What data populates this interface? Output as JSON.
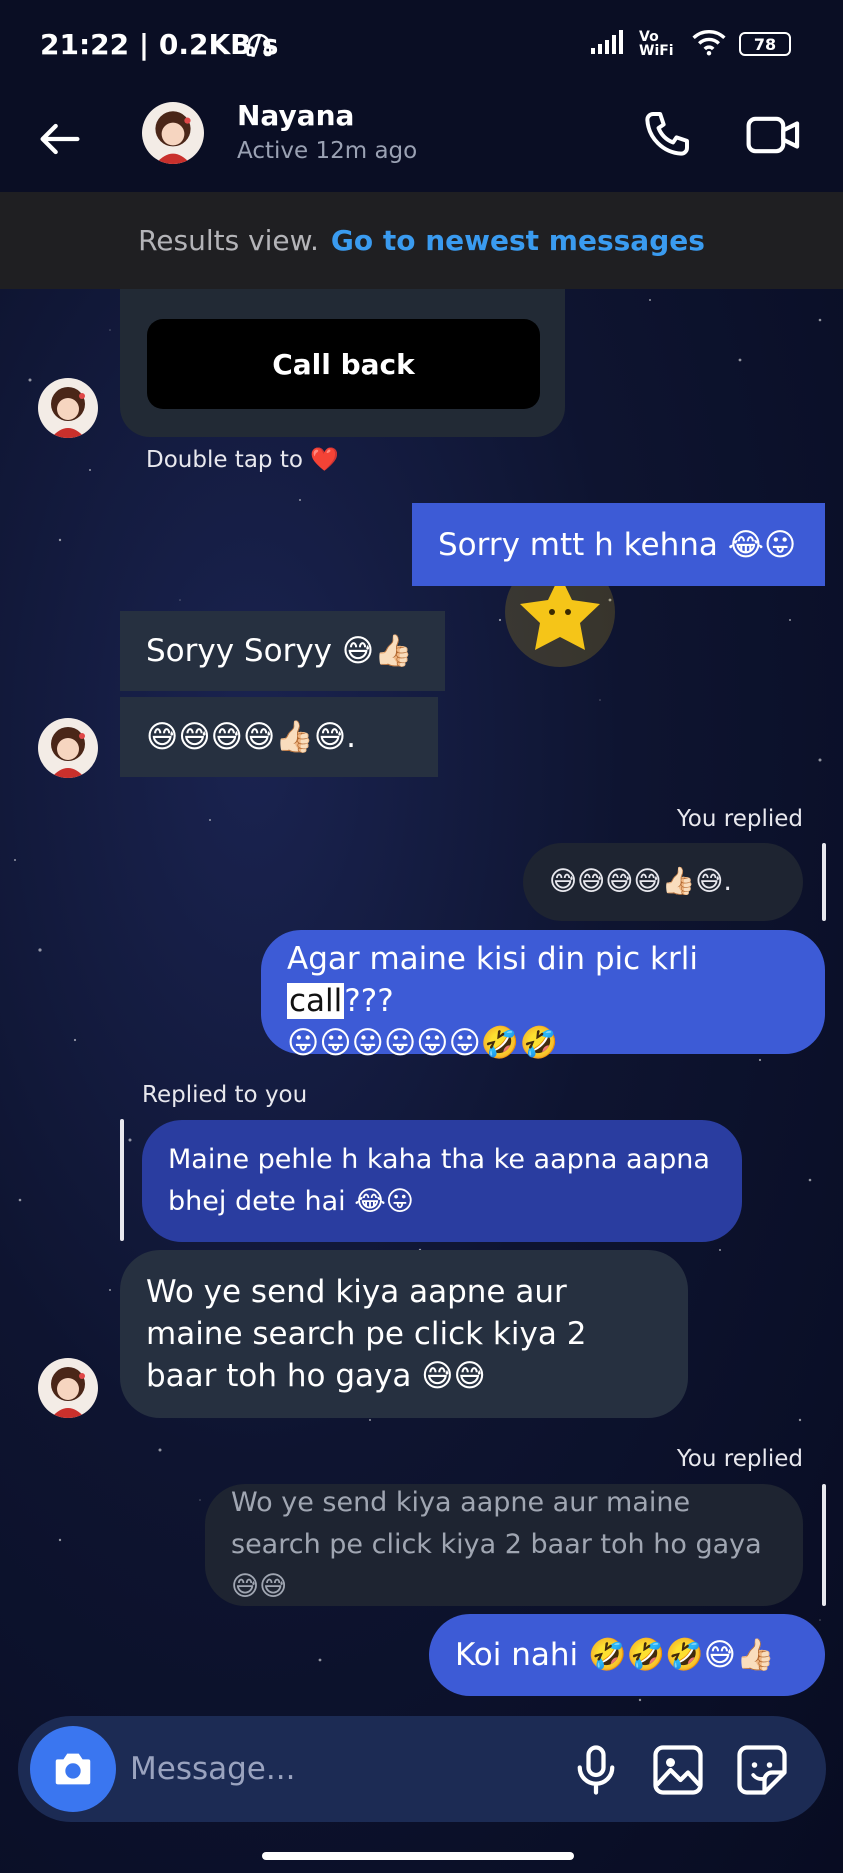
{
  "status": {
    "time": "21:22 | 0.2KB/s",
    "network": "Vo WiFi",
    "battery": "78"
  },
  "header": {
    "name": "Nayana",
    "status": "Active 12m ago"
  },
  "results": {
    "text": "Results view.",
    "link": "Go to newest messages"
  },
  "call_card": {
    "button": "Call back"
  },
  "hint": {
    "text": "Double tap to ❤️"
  },
  "messages": {
    "m1": "Sorry mtt h kehna 😂😛",
    "m2": "Soryy Soryy 😅👍🏻",
    "m3": "😅😅😅😅👍🏻😅.",
    "you_replied_1": "You replied",
    "m4_quote": "😅😅😅😅👍🏻😅.",
    "m4_a": "Agar maine kisi din pic krli ",
    "m4_hl": "call",
    "m4_b": "???",
    "m4_c": "😛😛😛😛😛😛🤣🤣",
    "replied_to_you": "Replied to you",
    "m5_quote": "Maine pehle h kaha tha ke aapna aapna bhej dete hai 😂😛",
    "m5": "Wo ye send kiya aapne aur maine search pe click kiya 2 baar toh ho gaya 😅😅",
    "you_replied_2": "You replied",
    "m6_quote": "Wo ye send kiya aapne aur maine search pe click kiya 2 baar toh ho gaya 😅😅",
    "m6": "Koi nahi 🤣🤣🤣😅👍🏻"
  },
  "composer": {
    "placeholder": "Message..."
  },
  "icons": [
    "back-arrow-icon",
    "phone-icon",
    "video-icon",
    "camera-icon",
    "microphone-icon",
    "gallery-icon",
    "sticker-icon",
    "headphones-icon",
    "signal-icon",
    "wifi-icon"
  ],
  "colors": {
    "outgoing": "#3d5bd6",
    "incoming": "#263040",
    "link": "#3a9bf0",
    "camera": "#3a76f0"
  }
}
